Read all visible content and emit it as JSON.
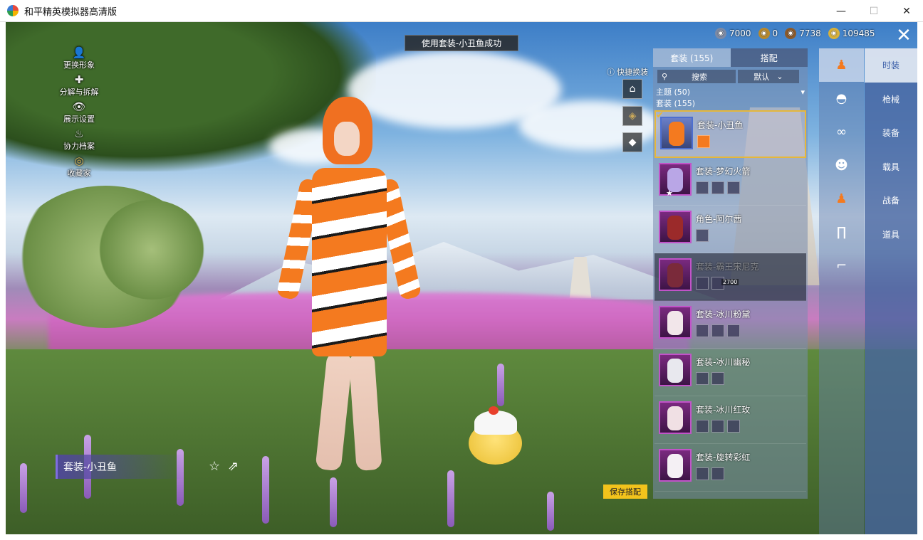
{
  "window": {
    "title": "和平精英模拟器高清版",
    "controls": {
      "minimize": "—",
      "maximize": "☐",
      "close": "✕"
    }
  },
  "toast": "使用套装-小丑鱼成功",
  "left_menu": [
    {
      "label": "更换形象",
      "icon": "person-icon",
      "glyph": "👤"
    },
    {
      "label": "分解与拆解",
      "icon": "puzzle-icon",
      "glyph": "✚"
    },
    {
      "label": "展示设置",
      "icon": "eye-icon",
      "glyph": "👁"
    },
    {
      "label": "协力档案",
      "icon": "flame-icon",
      "glyph": "♨"
    },
    {
      "label": "收藏家",
      "icon": "collector-badge-icon",
      "glyph": "◎"
    }
  ],
  "currencies": [
    {
      "value": "7000",
      "icon": "coin-silver-icon",
      "color": "#7c8aa5"
    },
    {
      "value": "0",
      "icon": "coin-gold-icon",
      "color": "#b8892c"
    },
    {
      "value": "7738",
      "icon": "coin-bronze-icon",
      "color": "#8b5a2b"
    },
    {
      "value": "109485",
      "icon": "coin-yellow-icon",
      "color": "#d9b23a"
    }
  ],
  "quick_change_label": "快捷换装",
  "panel": {
    "tabs": [
      {
        "label": "套装 (155)"
      },
      {
        "label": "搭配"
      }
    ],
    "search_label": "搜索",
    "sort_label": "默认",
    "filter_theme": "主题 (50)",
    "filter_suits": "套装 (155)",
    "items": [
      {
        "name": "套装-小丑鱼",
        "selected": true
      },
      {
        "name": "套装-梦幻火箭"
      },
      {
        "name": "角色-阿尔茜"
      },
      {
        "name": "套装-霸王宋尼克",
        "price": "2700"
      },
      {
        "name": "套装-冰川粉黛"
      },
      {
        "name": "套装-冰川幽秘"
      },
      {
        "name": "套装-冰川红玫"
      },
      {
        "name": "套装-旋转彩虹"
      }
    ]
  },
  "categories": [
    {
      "label": "时装",
      "icon": "outfit-icon",
      "active": true
    },
    {
      "label": "枪械",
      "icon": "cap-icon"
    },
    {
      "label": "装备",
      "icon": "goggles-icon"
    },
    {
      "label": "载具",
      "icon": "mask-icon"
    },
    {
      "label": "战备",
      "icon": "suit-icon"
    },
    {
      "label": "道具",
      "icon": "pants-icon"
    }
  ],
  "outfit_name": "套装-小丑鱼",
  "save_label": "保存搭配",
  "accent_color": "#f2c31c"
}
